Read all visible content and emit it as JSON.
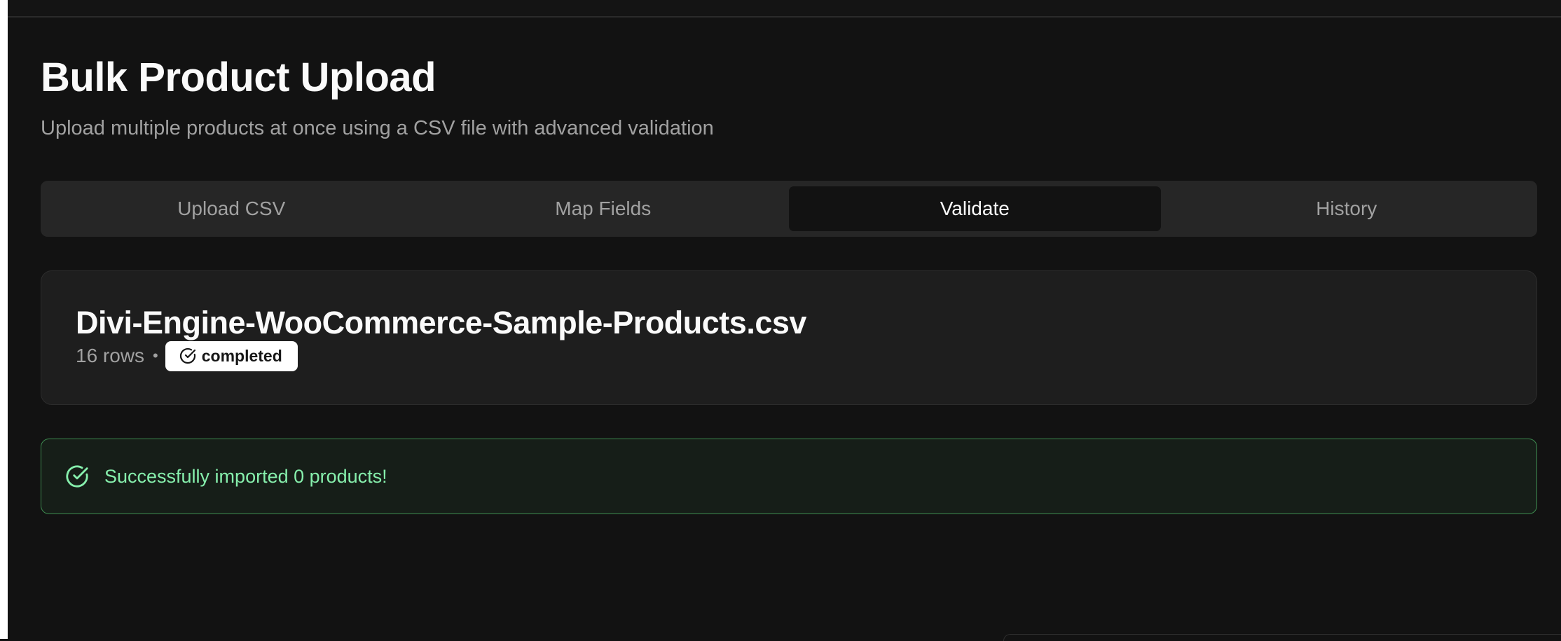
{
  "header": {
    "title": "Bulk Product Upload",
    "subtitle": "Upload multiple products at once using a CSV file with advanced validation"
  },
  "tabs": [
    {
      "label": "Upload CSV",
      "active": false
    },
    {
      "label": "Map Fields",
      "active": false
    },
    {
      "label": "Validate",
      "active": true
    },
    {
      "label": "History",
      "active": false
    }
  ],
  "file": {
    "name": "Divi-Engine-WooCommerce-Sample-Products.csv",
    "rows": "16 rows",
    "separator": "•",
    "status": "completed",
    "status_icon": "check-circle-icon"
  },
  "alert": {
    "icon": "check-circle-icon",
    "message": "Successfully imported 0 products!"
  },
  "colors": {
    "background": "#121212",
    "success": "#86efac",
    "success_border": "#3d8a4f"
  }
}
